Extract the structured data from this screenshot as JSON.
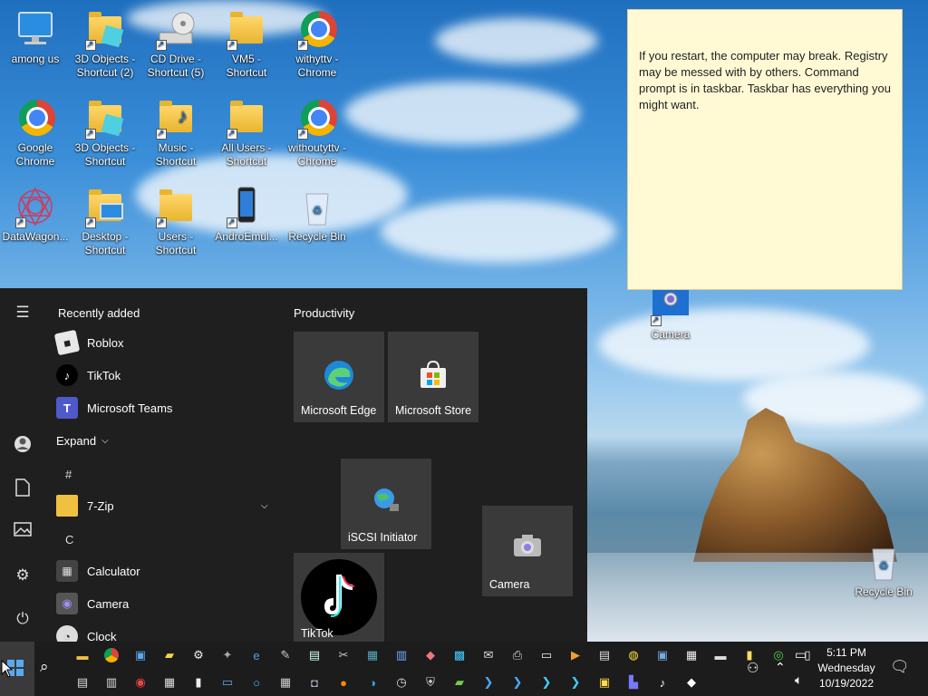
{
  "desktop": {
    "icons": [
      {
        "label": "among us"
      },
      {
        "label": "3D Objects - Shortcut (2)"
      },
      {
        "label": "CD Drive - Shortcut (5)"
      },
      {
        "label": "VM5 - Shortcut"
      },
      {
        "label": "withyttv - Chrome"
      },
      {
        "label": "Google Chrome"
      },
      {
        "label": "3D Objects - Shortcut"
      },
      {
        "label": "Music - Shortcut"
      },
      {
        "label": "All Users - Shortcut"
      },
      {
        "label": "withoutyttv - Chrome"
      },
      {
        "label": "DataWagon..."
      },
      {
        "label": "Desktop - Shortcut"
      },
      {
        "label": "Users - Shortcut"
      },
      {
        "label": "AndroEmul..."
      },
      {
        "label": "Recycle Bin"
      },
      {
        "label": "Camera"
      },
      {
        "label": "Recycle Bin"
      }
    ]
  },
  "sticky": {
    "text": "If you restart, the computer may break. Registry may be messed with by others. Command prompt is in taskbar. Taskbar has everything you might want."
  },
  "start_menu": {
    "recently_added_label": "Recently added",
    "recent": [
      "Roblox",
      "TikTok",
      "Microsoft Teams"
    ],
    "expand_label": "Expand",
    "letter_hash": "#",
    "seven_zip": "7-Zip",
    "letter_c": "C",
    "apps_c": [
      "Calculator",
      "Camera",
      "Clock"
    ],
    "productivity_label": "Productivity",
    "tiles": {
      "edge": "Microsoft Edge",
      "store": "Microsoft Store",
      "iscsi": "iSCSI Initiator",
      "camera": "Camera",
      "tiktok": "TikTok"
    }
  },
  "taskbar": {
    "time": "5:11 PM",
    "day": "Wednesday",
    "date": "10/19/2022"
  }
}
